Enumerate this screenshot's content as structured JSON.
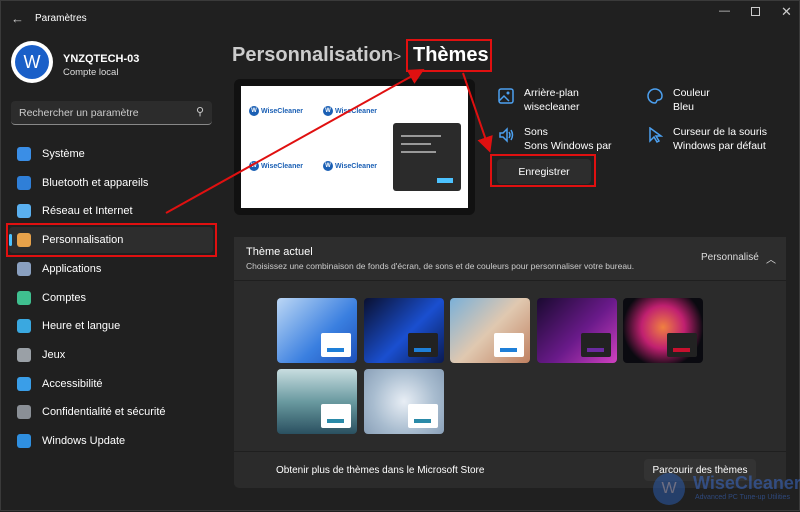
{
  "window": {
    "title": "Paramètres",
    "back_icon": "back-arrow-icon"
  },
  "user": {
    "name": "YNZQTECH-03",
    "account": "Compte local"
  },
  "search": {
    "placeholder": "Rechercher un paramètre"
  },
  "sidebar": {
    "items": [
      {
        "label": "Système",
        "icon": "system-icon",
        "color": "#3a8ee6"
      },
      {
        "label": "Bluetooth et appareils",
        "icon": "bluetooth-icon",
        "color": "#2f7fd8"
      },
      {
        "label": "Réseau et Internet",
        "icon": "wifi-icon",
        "color": "#5ab0f0"
      },
      {
        "label": "Personnalisation",
        "icon": "brush-icon",
        "color": "#e7a24a",
        "selected": true
      },
      {
        "label": "Applications",
        "icon": "apps-icon",
        "color": "#8aa0c0"
      },
      {
        "label": "Comptes",
        "icon": "accounts-icon",
        "color": "#3fbf8f"
      },
      {
        "label": "Heure et langue",
        "icon": "time-language-icon",
        "color": "#3aa8e0"
      },
      {
        "label": "Jeux",
        "icon": "gamepad-icon",
        "color": "#9aa0a6"
      },
      {
        "label": "Accessibilité",
        "icon": "accessibility-icon",
        "color": "#3a9ee8"
      },
      {
        "label": "Confidentialité et sécurité",
        "icon": "shield-icon",
        "color": "#8a8f96"
      },
      {
        "label": "Windows Update",
        "icon": "update-icon",
        "color": "#2f8fe0"
      }
    ]
  },
  "breadcrumb": {
    "parent": "Personnalisation",
    "separator": ">",
    "current": "Thèmes"
  },
  "preview": {
    "logo_text": "WiseCleaner"
  },
  "props": [
    {
      "title": "Arrière-plan",
      "value": "wisecleaner",
      "icon": "image-icon"
    },
    {
      "title": "Couleur",
      "value": "Bleu",
      "icon": "palette-icon"
    },
    {
      "title": "Sons",
      "value": "Sons Windows par",
      "icon": "speaker-icon"
    },
    {
      "title": "Curseur de la souris",
      "value": "Windows par défaut",
      "icon": "cursor-icon"
    }
  ],
  "save_button": "Enregistrer",
  "current_theme": {
    "title": "Thème actuel",
    "description": "Choisissez une combinaison de fonds d'écran, de sons et de couleurs pour personnaliser votre bureau.",
    "value": "Personnalisé"
  },
  "themes": [
    {
      "bg": "linear-gradient(135deg,#bcd7f5,#3a7fe0 60%,#1d4fb8)",
      "accent": "#1e7fd8",
      "mini": "#fff"
    },
    {
      "bg": "linear-gradient(135deg,#0a1030,#1a4fd0 55%,#0a1a50)",
      "accent": "#1e7fd8",
      "mini": "#222"
    },
    {
      "bg": "linear-gradient(135deg,#7ab0d8,#e0c8b0 50%,#c08060)",
      "accent": "#1e7fd8",
      "mini": "#fff"
    },
    {
      "bg": "linear-gradient(135deg,#1a0a30,#6a1a8a 55%,#d040c0)",
      "accent": "#6a2aa0",
      "mini": "#222"
    },
    {
      "bg": "radial-gradient(circle at 50% 45%,#f08040,#c02070 40%,#0a0a10 75%)",
      "accent": "#c8102e",
      "mini": "#222"
    },
    {
      "bg": "linear-gradient(180deg,#c8dde0,#6a9aa0 50%,#2a5060)",
      "accent": "#2a8aa8",
      "mini": "#fff"
    },
    {
      "bg": "radial-gradient(circle at 50% 50%,#e8eef5,#a8bccf 60%,#8aa0b8)",
      "accent": "#2a8aa8",
      "mini": "#fff"
    }
  ],
  "store": {
    "text": "Obtenir plus de thèmes dans le Microsoft Store",
    "button": "Parcourir des thèmes"
  },
  "watermark": {
    "brand": "WiseCleaner",
    "tagline": "Advanced PC Tune-up Utilities"
  },
  "colors": {
    "accent": "#4cc2ff",
    "annotation": "#e01010"
  }
}
